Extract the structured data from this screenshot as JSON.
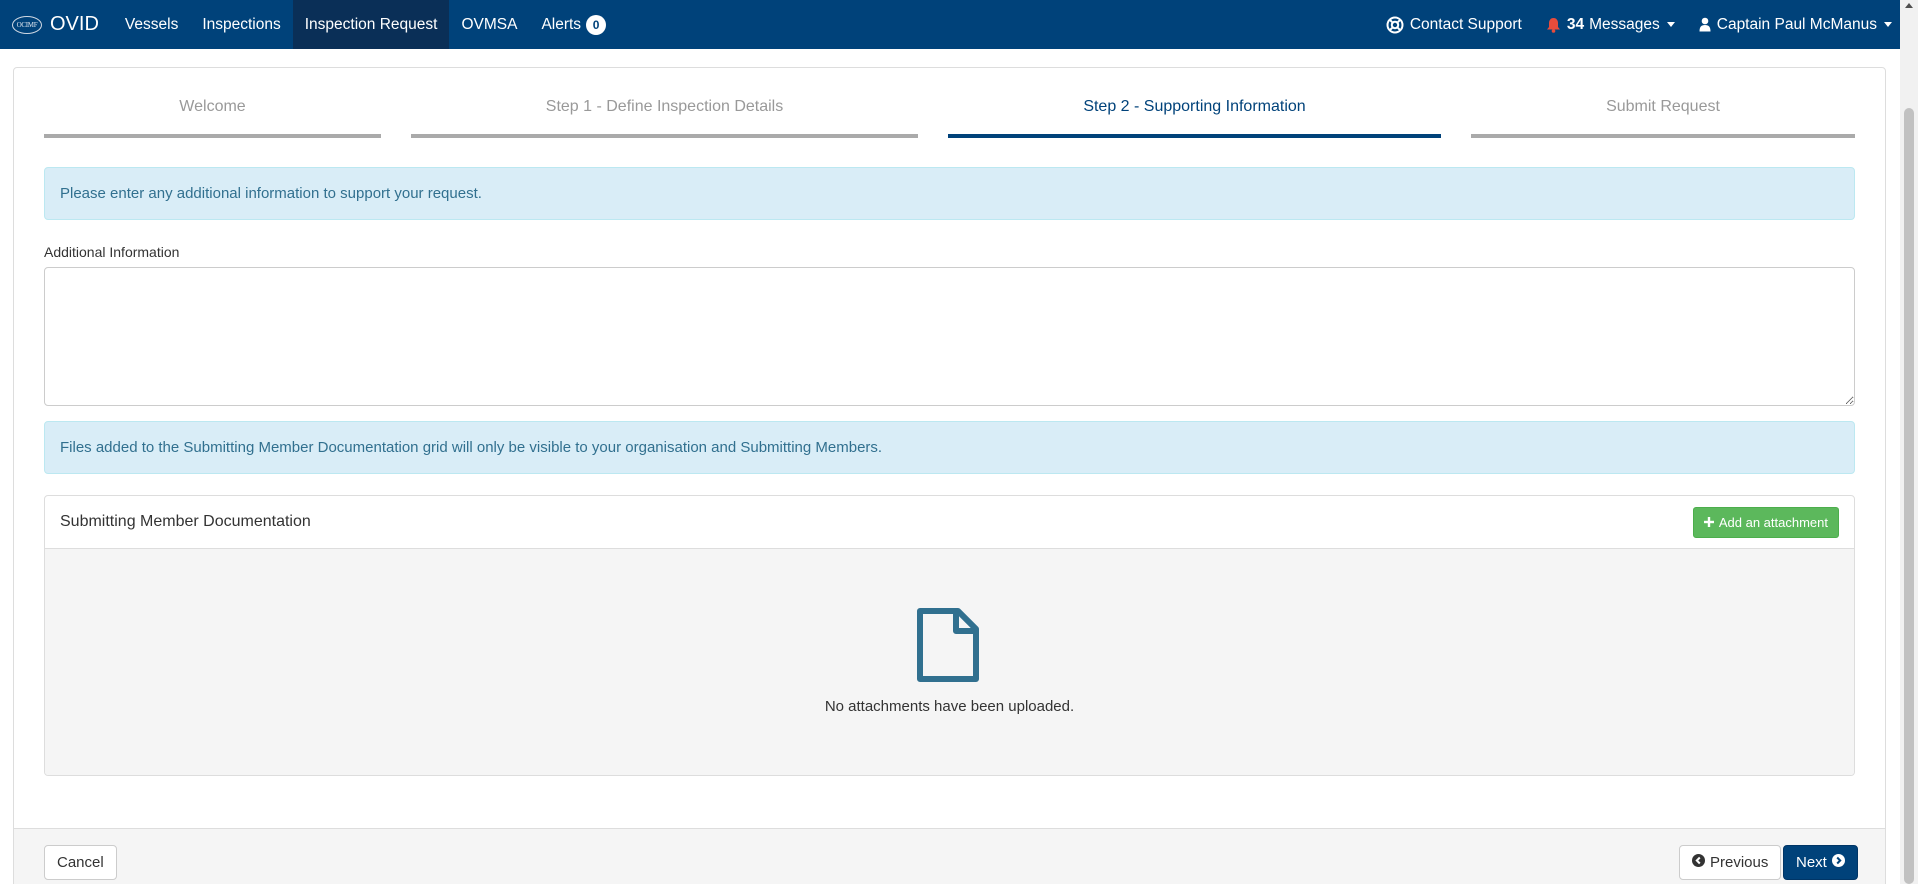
{
  "navbar": {
    "brand_logo_text": "OCIMF",
    "brand_name": "OVID",
    "items": [
      {
        "label": "Vessels"
      },
      {
        "label": "Inspections"
      },
      {
        "label": "Inspection Request"
      },
      {
        "label": "OVMSA"
      },
      {
        "label": "Alerts"
      }
    ],
    "alerts_count": "0",
    "contact_support": "Contact Support",
    "messages_count": "34",
    "messages_label": "Messages",
    "user_name": "Captain Paul McManus"
  },
  "steps": [
    {
      "label": "Welcome"
    },
    {
      "label": "Step 1 - Define Inspection Details"
    },
    {
      "label": "Step 2 - Supporting Information"
    },
    {
      "label": "Submit Request"
    }
  ],
  "info_alert": "Please enter any additional information to support your request.",
  "additional_info": {
    "label": "Additional Information",
    "value": ""
  },
  "files_alert": "Files added to the Submitting Member Documentation grid will only be visible to your organisation and Submitting Members.",
  "documentation": {
    "title": "Submitting Member Documentation",
    "add_button": "Add an attachment",
    "empty_text": "No attachments have been uploaded."
  },
  "footer": {
    "cancel": "Cancel",
    "previous": "Previous",
    "next": "Next"
  },
  "colors": {
    "navbar": "#00427a",
    "navbar_active": "#0a2f57",
    "accent": "#00427a",
    "info_bg": "#d9edf7",
    "info_text": "#31708f",
    "success": "#5cb85c",
    "messages_bell": "#e74c3c",
    "file_icon": "#31708f"
  }
}
